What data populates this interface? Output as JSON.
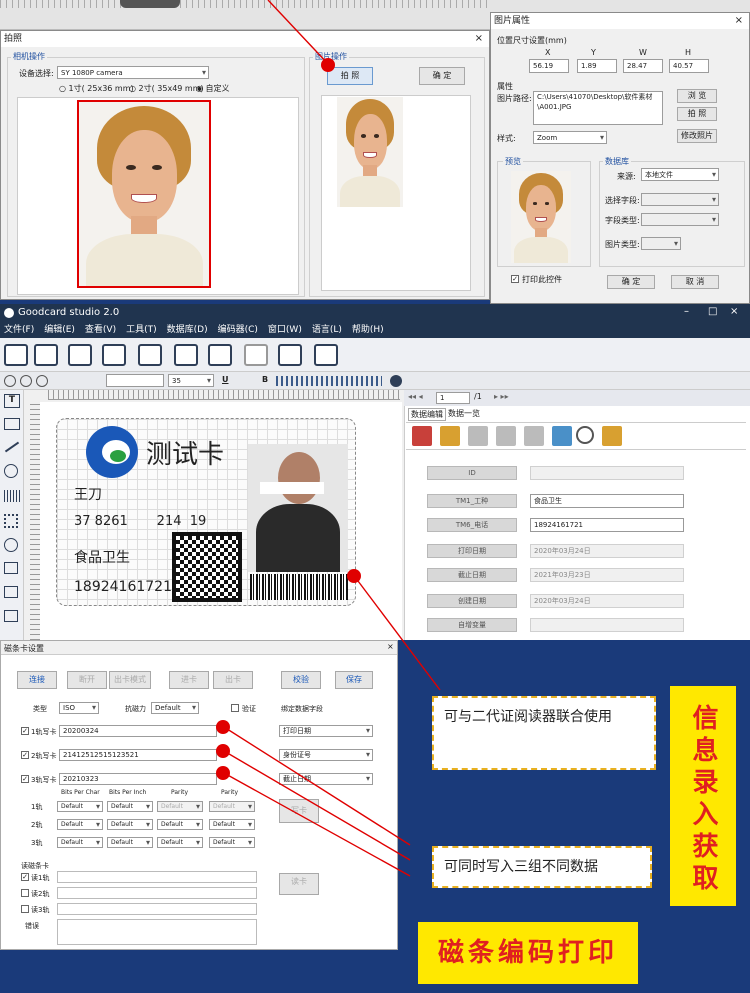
{
  "top_strip": {
    "bg": "#e8e8e8"
  },
  "photo_dialog": {
    "title": "拍照",
    "close": "×",
    "camera_group": "相机操作",
    "device_label": "设备选择:",
    "device_value": "SY 1080P camera",
    "size_options": [
      "1寸( 25x36 mm)",
      "2寸( 35x49 mm)",
      "自定义"
    ],
    "photo_group": "图片操作",
    "capture_btn": "拍 照",
    "confirm_btn": "确 定"
  },
  "img_props": {
    "title": "图片属性",
    "close": "×",
    "pos_label": "位置尺寸设置(mm)",
    "cols": [
      "X",
      "Y",
      "W",
      "H"
    ],
    "vals": [
      "56.19",
      "1.89",
      "28.47",
      "40.57"
    ],
    "attr_label": "属性",
    "path_label": "图片路径:",
    "path_value": "C:\\Users\\41070\\Desktop\\软件素材\\A001.JPG",
    "browse_btn": "浏 览",
    "photo_btn": "拍 照",
    "style_label": "样式:",
    "style_value": "Zoom",
    "modify_btn": "修改照片",
    "preview_label": "预览",
    "db_label": "数据库",
    "source_label": "来源:",
    "source_value": "本地文件",
    "field_label": "选择字段:",
    "type_label": "字段类型:",
    "pic_type_label": "图片类型:",
    "print_chk": "打印此控件",
    "ok_btn": "确 定",
    "cancel_btn": "取 消"
  },
  "main_app": {
    "title": "Goodcard studio 2.0",
    "win_ctrls": [
      "–",
      "□",
      "×"
    ],
    "menu": [
      "文件(F)",
      "编辑(E)",
      "查看(V)",
      "工具(T)",
      "数据库(D)",
      "编码器(C)",
      "窗口(W)",
      "语言(L)",
      "帮助(H)"
    ],
    "font_size": "35",
    "nav_page": "1",
    "nav_total": "/1",
    "tabs": [
      "数据编辑",
      "数据一览"
    ],
    "fields": [
      {
        "label": "ID",
        "value": ""
      },
      {
        "label": "TM1_工种",
        "value": "食品卫生"
      },
      {
        "label": "TM6_电话",
        "value": "18924161721"
      },
      {
        "label": "打印日期",
        "value": "2020年03月24日"
      },
      {
        "label": "截止日期",
        "value": "2021年03月23日"
      },
      {
        "label": "创建日期",
        "value": "2020年03月24日"
      },
      {
        "label": "自增变量",
        "value": ""
      }
    ]
  },
  "card": {
    "logo_text": "测试卡",
    "name": "王刀",
    "id_number": "37 8261       214  19",
    "job": "食品卫生",
    "phone": "18924161721"
  },
  "mag_dialog": {
    "title": "磁条卡设置",
    "close": "×",
    "buttons": [
      "连接",
      "断开",
      "出卡模式",
      "进卡",
      "出卡",
      "校验",
      "保存"
    ],
    "type_label": "类型",
    "type_value": "ISO",
    "coercive_label": "抗磁力",
    "coercive_value": "Default",
    "verify_label": "验证",
    "bind_label": "绑定数据字段",
    "tracks": [
      {
        "label": "1轨写卡",
        "value": "20200324",
        "bind": "打印日期"
      },
      {
        "label": "2轨写卡",
        "value": "21412512515123521",
        "bind": "身份证号"
      },
      {
        "label": "3轨写卡",
        "value": "20210323",
        "bind": "截止日期"
      }
    ],
    "param_headers": [
      "Bits Per Char",
      "Bits Per Inch",
      "Parity",
      "Parity"
    ],
    "param_rows": [
      {
        "label": "1轨",
        "vals": [
          "Default",
          "Default",
          "Default",
          "Default"
        ]
      },
      {
        "label": "2轨",
        "vals": [
          "Default",
          "Default",
          "Default",
          "Default"
        ]
      },
      {
        "label": "3轨",
        "vals": [
          "Default",
          "Default",
          "Default",
          "Default"
        ]
      }
    ],
    "write_btn": "写卡",
    "read_label": "读磁条卡",
    "read_tracks": [
      "读1轨",
      "读2轨",
      "读3轨"
    ],
    "read_btn": "读卡",
    "error_label": "错误"
  },
  "callouts": {
    "reader": "可与二代证阅读器联合使用",
    "three_groups": "可同时写入三组不同数据",
    "info_entry": "信息录入获取",
    "mag_print": "磁条编码打印"
  },
  "colors": {
    "accent_red": "#e00000",
    "yellow": "#ffe800",
    "blue_bg": "#1a3a7a"
  }
}
